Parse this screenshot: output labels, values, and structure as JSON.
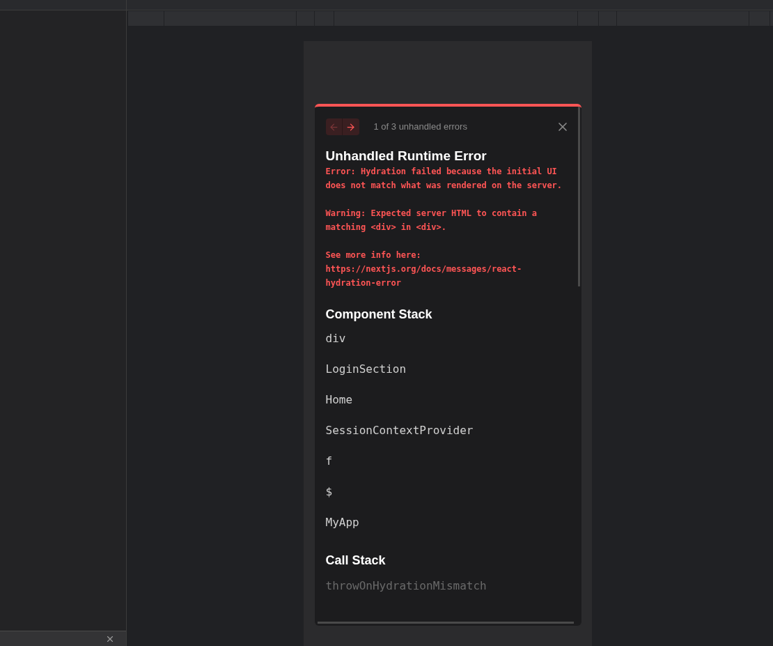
{
  "overlay": {
    "pager": "1 of 3 unhandled errors",
    "title": "Unhandled Runtime Error",
    "message": [
      "Error: Hydration failed because the initial UI does not match what was rendered on the server.",
      "Warning: Expected server HTML to contain a matching <div> in <div>.",
      "See more info here: https://nextjs.org/docs/messages/react-hydration-error"
    ],
    "component_stack": {
      "heading": "Component Stack",
      "frames": [
        "div",
        "LoginSection",
        "Home",
        "SessionContextProvider",
        "f",
        "$",
        "MyApp"
      ]
    },
    "call_stack": {
      "heading": "Call Stack",
      "frames": [
        "throwOnHydrationMismatch"
      ]
    },
    "prev_disabled": true,
    "next_disabled": false
  }
}
